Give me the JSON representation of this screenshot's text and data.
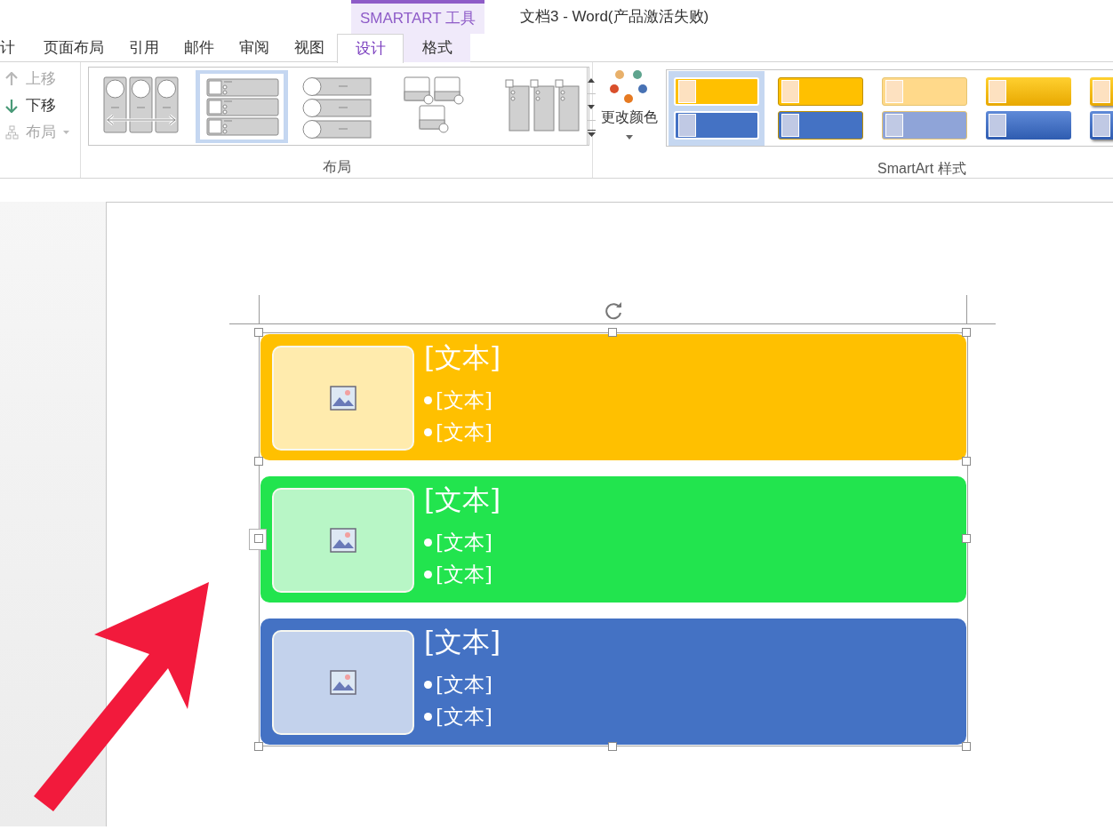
{
  "window": {
    "title": "文档3 - Word(产品激活失败)"
  },
  "contextual_tab_group": "SMARTART 工具",
  "tabs": [
    {
      "label": "计",
      "selected": false,
      "contextual": false
    },
    {
      "label": "页面布局",
      "selected": false,
      "contextual": false
    },
    {
      "label": "引用",
      "selected": false,
      "contextual": false
    },
    {
      "label": "邮件",
      "selected": false,
      "contextual": false
    },
    {
      "label": "审阅",
      "selected": false,
      "contextual": false
    },
    {
      "label": "视图",
      "selected": false,
      "contextual": false
    },
    {
      "label": "设计",
      "selected": true,
      "contextual": true
    },
    {
      "label": "格式",
      "selected": false,
      "contextual": true
    }
  ],
  "create_group": [
    {
      "kind": "up",
      "label": "上移",
      "disabled": true
    },
    {
      "kind": "down",
      "label": "下移",
      "disabled": false
    },
    {
      "kind": "layout",
      "label": "布局",
      "disabled": true
    }
  ],
  "layouts": {
    "label": "布局",
    "items": [
      {
        "kind": "circle-columns",
        "selected": false
      },
      {
        "kind": "picture-list",
        "selected": true
      },
      {
        "kind": "circle-list",
        "selected": false
      },
      {
        "kind": "picture-grid",
        "selected": false
      },
      {
        "kind": "tab-columns",
        "selected": false
      }
    ]
  },
  "change_colors": {
    "label": "更改颜色"
  },
  "styles": {
    "label": "SmartArt 样式",
    "items": [
      {
        "kind": "flat",
        "selected": true
      },
      {
        "kind": "outline",
        "selected": false
      },
      {
        "kind": "light",
        "selected": false
      },
      {
        "kind": "gradient",
        "selected": false
      },
      {
        "kind": "shadow",
        "selected": false
      }
    ]
  },
  "smartart": {
    "rows": [
      {
        "color": "#ffc000",
        "title": "[文本]",
        "bullets": [
          "[文本]",
          "[文本]"
        ]
      },
      {
        "color": "#22e44e",
        "title": "[文本]",
        "bullets": [
          "[文本]",
          "[文本]"
        ]
      },
      {
        "color": "#4472c4",
        "title": "[文本]",
        "bullets": [
          "[文本]",
          "[文本]"
        ]
      }
    ]
  }
}
